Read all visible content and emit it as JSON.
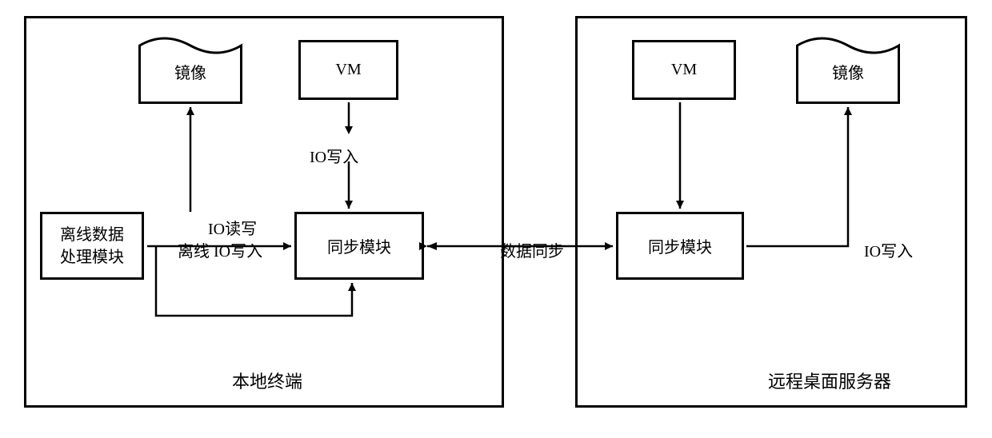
{
  "left": {
    "title": "本地终端",
    "mirror": "镜像",
    "vm": "VM",
    "offlineModule": "离线数据\n处理模块",
    "syncModule": "同步模块",
    "ioRW": "IO读写",
    "offlineIOWrite": "离线 IO写入",
    "ioWrite": "IO写入"
  },
  "middle": {
    "dataSync": "数据同步"
  },
  "right": {
    "title": "远程桌面服务器",
    "vm": "VM",
    "mirror": "镜像",
    "syncModule": "同步模块",
    "ioWrite": "IO写入"
  }
}
